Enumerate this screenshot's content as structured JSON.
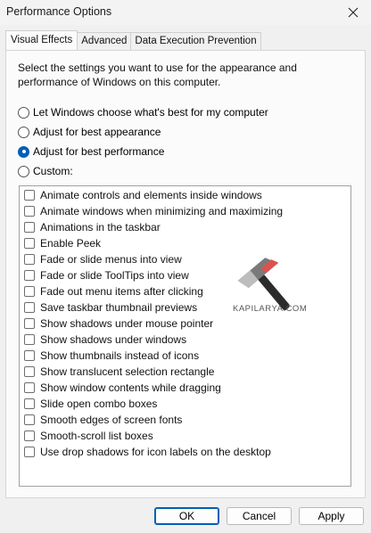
{
  "window": {
    "title": "Performance Options"
  },
  "tabs": [
    {
      "label": "Visual Effects"
    },
    {
      "label": "Advanced"
    },
    {
      "label": "Data Execution Prevention"
    }
  ],
  "description": "Select the settings you want to use for the appearance and performance of Windows on this computer.",
  "radios": [
    {
      "label": "Let Windows choose what's best for my computer",
      "checked": false
    },
    {
      "label": "Adjust for best appearance",
      "checked": false
    },
    {
      "label": "Adjust for best performance",
      "checked": true
    },
    {
      "label": "Custom:",
      "checked": false
    }
  ],
  "effects": [
    {
      "label": "Animate controls and elements inside windows",
      "checked": false
    },
    {
      "label": "Animate windows when minimizing and maximizing",
      "checked": false
    },
    {
      "label": "Animations in the taskbar",
      "checked": false
    },
    {
      "label": "Enable Peek",
      "checked": false
    },
    {
      "label": "Fade or slide menus into view",
      "checked": false
    },
    {
      "label": "Fade or slide ToolTips into view",
      "checked": false
    },
    {
      "label": "Fade out menu items after clicking",
      "checked": false
    },
    {
      "label": "Save taskbar thumbnail previews",
      "checked": false
    },
    {
      "label": "Show shadows under mouse pointer",
      "checked": false
    },
    {
      "label": "Show shadows under windows",
      "checked": false
    },
    {
      "label": "Show thumbnails instead of icons",
      "checked": false
    },
    {
      "label": "Show translucent selection rectangle",
      "checked": false
    },
    {
      "label": "Show window contents while dragging",
      "checked": false
    },
    {
      "label": "Slide open combo boxes",
      "checked": false
    },
    {
      "label": "Smooth edges of screen fonts",
      "checked": false
    },
    {
      "label": "Smooth-scroll list boxes",
      "checked": false
    },
    {
      "label": "Use drop shadows for icon labels on the desktop",
      "checked": false
    }
  ],
  "watermark": {
    "text": "KAPILARYA.COM",
    "icon": "hammer-logo-icon"
  },
  "buttons": {
    "ok": "OK",
    "cancel": "Cancel",
    "apply": "Apply"
  },
  "colors": {
    "accent": "#005fb8",
    "panel": "#fbfbfb",
    "window": "#f0f0f0"
  }
}
